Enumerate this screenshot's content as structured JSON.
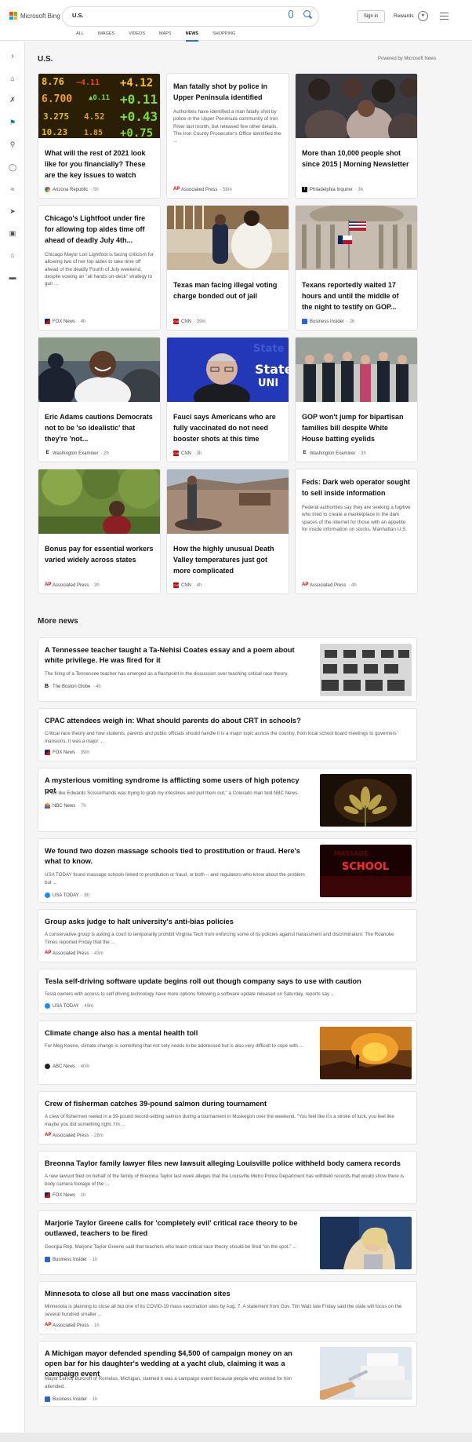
{
  "header": {
    "logo": "Microsoft Bing",
    "query": "U.S.",
    "signin_label": "Sign in",
    "rewards_label": "Rewards",
    "rewards_icon": "trophy-icon",
    "tabs": [
      {
        "label": "ALL"
      },
      {
        "label": "IMAGES"
      },
      {
        "label": "VIDEOS"
      },
      {
        "label": "MAPS"
      },
      {
        "label": "NEWS",
        "active": true
      },
      {
        "label": "SHOPPING"
      }
    ]
  },
  "rail": {
    "icons": [
      "chevron-right-icon",
      "home-icon",
      "wrench-icon",
      "flag-icon",
      "location-icon",
      "globe-icon",
      "health-icon",
      "rocket-icon",
      "film-icon",
      "bank-icon",
      "card-icon"
    ]
  },
  "section": {
    "title": "U.S.",
    "powered_by": "Powered by Microsoft News"
  },
  "cards": [
    {
      "title": "What will the rest of 2021 look like for you financially? These are the key issues to watch",
      "source": "Arizona Republic",
      "time": "5h",
      "image": "stock-ticker"
    },
    {
      "title": "Man fatally shot by police in Upper Peninsula identified",
      "snippet": "Authorities have identified a man fatally shot by police in the Upper Peninsula community of Iron River last month, but released few other details. The Iron County Prosecutor's Office identified the ...",
      "source": "Associated Press",
      "time": "58m"
    },
    {
      "title": "More than 10,000 people shot since 2015 | Morning Newsletter",
      "source": "Philadelphia Inquirer",
      "time": "3h",
      "image": "crowd"
    },
    {
      "title": "Chicago's Lightfoot under fire for allowing top aides time off ahead of deadly July 4th...",
      "snippet": "Chicago Mayor Lori Lightfoot is facing criticism for allowing two of her top aides to take time off ahead of the deadly Fourth of July weekend, despite vowing an \"all hands on-deck\" strategy to gun ...",
      "source": "FOX News",
      "time": "4h"
    },
    {
      "title": "Texas man facing illegal voting charge bonded out of jail",
      "source": "CNN",
      "time": "39m",
      "image": "courthouse"
    },
    {
      "title": "Texans reportedly waited 17 hours and until the middle of the night to testify on GOP...",
      "source": "Business Insider",
      "time": "2h",
      "image": "capitol"
    },
    {
      "title": "Eric Adams cautions Democrats not to be 'so idealistic' that they're 'not...",
      "source": "Washington Examiner",
      "time": "2h",
      "image": "adams"
    },
    {
      "title": "Fauci says Americans who are fully vaccinated do not need booster shots at this time",
      "source": "CNN",
      "time": "3h",
      "image": "fauci"
    },
    {
      "title": "GOP won't jump for bipartisan families bill despite White House batting eyelids",
      "source": "Washington Examiner",
      "time": "3h",
      "image": "group"
    },
    {
      "title": "Bonus pay for essential workers varied widely across states",
      "source": "Associated Press",
      "time": "3h",
      "image": "worker"
    },
    {
      "title": "How the highly unusual Death Valley temperatures just got more complicated",
      "source": "CNN",
      "time": "4h",
      "image": "desert"
    },
    {
      "title": "Feds: Dark web operator sought to sell inside information",
      "snippet": "Federal authorities say they are seeking a fugitive who tried to create a marketplace in the dark spaces of the internet for those with an appetite for inside information on stocks. Manhattan U.S.",
      "source": "Associated Press",
      "time": "4h"
    }
  ],
  "more_news": {
    "title": "More news",
    "items": [
      {
        "title": "A Tennessee teacher taught a Ta-Nehisi Coates essay and a poem about white privilege. He was fired for it",
        "snippet": "The firing of a Tennessee teacher has emerged as a flashpoint in the discussion over teaching critical race theory.",
        "source": "The Boston Globe",
        "time": "4h",
        "thumb": "classroom"
      },
      {
        "title": "CPAC attendees weigh in: What should parents do about CRT in schools?",
        "snippet": "Critical race theory and how students, parents and public officials should handle it is a major topic across the country, from local school board meetings to governors' mansions.  It was a major ...",
        "source": "FOX News",
        "time": "39m"
      },
      {
        "title": "A mysterious vomiting syndrome is afflicting some users of high potency pot",
        "snippet": "\"It felt like Edwards Scissorhands was trying to grab my intestines and pull them out,\" a Colorado man told NBC News.",
        "source": "NBC News",
        "time": "7h",
        "thumb": "cannabis"
      },
      {
        "title": "We found two dozen massage schools tied to prostitution or fraud. Here's what to know.",
        "snippet": "USA TODAY found massage schools linked to prostitution or fraud, or both -- and regulators who know about the problem but ...",
        "source": "USA TODAY",
        "time": "8h",
        "thumb": "school-sign",
        "thumb_text": "SCHOOL"
      },
      {
        "title": "Group asks judge to halt university's anti-bias policies",
        "snippet": "A conservative group is asking a court to temporarily prohibit Virginia Tech from enforcing some of its policies against harassment and discrimination. The Roanoke Times reported Friday that the ...",
        "source": "Associated Press",
        "time": "43m"
      },
      {
        "title": "Tesla self-driving software update begins roll out though company says to use with caution",
        "snippet": "Tesla owners with access to self driving technology have more options following a software update released on Saturday, reports say ...",
        "source": "USA TODAY",
        "time": "49m"
      },
      {
        "title": "Climate change also has a mental health toll",
        "snippet": "For Meg Keene, climate change is something that not only needs to be addressed but is also very difficult to cope with ...",
        "source": "ABC News",
        "time": "40m",
        "thumb": "wildfire"
      },
      {
        "title": "Crew of fisherman catches 39-pound salmon during tournament",
        "snippet": "A crew of fishermen reeled in a 39-pound record-setting salmon during a tournament in Muskegon over the weekend. \"You feel like it's a stroke of luck, you feel like maybe you did something right. I'm ...",
        "source": "Associated Press",
        "time": "28m"
      },
      {
        "title": "Breonna Taylor family lawyer files new lawsuit alleging Louisville police withheld body camera records",
        "snippet": "A new lawsuit filed on behalf of the family of Breonna Taylor last week alleges that the Louisville Metro Police Department has withheld records that would show there is body camera footage of the ...",
        "source": "FOX News",
        "time": "1h"
      },
      {
        "title": "Marjorie Taylor Greene calls for 'completely evil' critical race theory to be outlawed, teachers to be fired",
        "snippet": "Georgia Rep. Marjorie Taylor Greene said that teachers who teach critical race theory should be fired \"on the spot.\" ...",
        "source": "Business Insider",
        "time": "1h",
        "thumb": "greene"
      },
      {
        "title": "Minnesota to close all but one mass vaccination sites",
        "snippet": "Minnesota is planning to close all but one of its COVID-19 mass vaccination sites by Aug. 7. A statement from Gov. Tim Walz late Friday said the state will focus on the several hundred smaller ...",
        "source": "Associated Press",
        "time": "1h"
      },
      {
        "title": "A Michigan mayor defended spending $4,500 of campaign money on an open bar for his daughter's wedding at a yacht club, claiming it was a campaign event",
        "snippet": "Mayor LeRoy Burcroff of Romulus, Michigan, claimed it was a campaign event because people who worked for him attended.",
        "source": "Business Insider",
        "time": "1h",
        "thumb": "cake"
      }
    ]
  }
}
